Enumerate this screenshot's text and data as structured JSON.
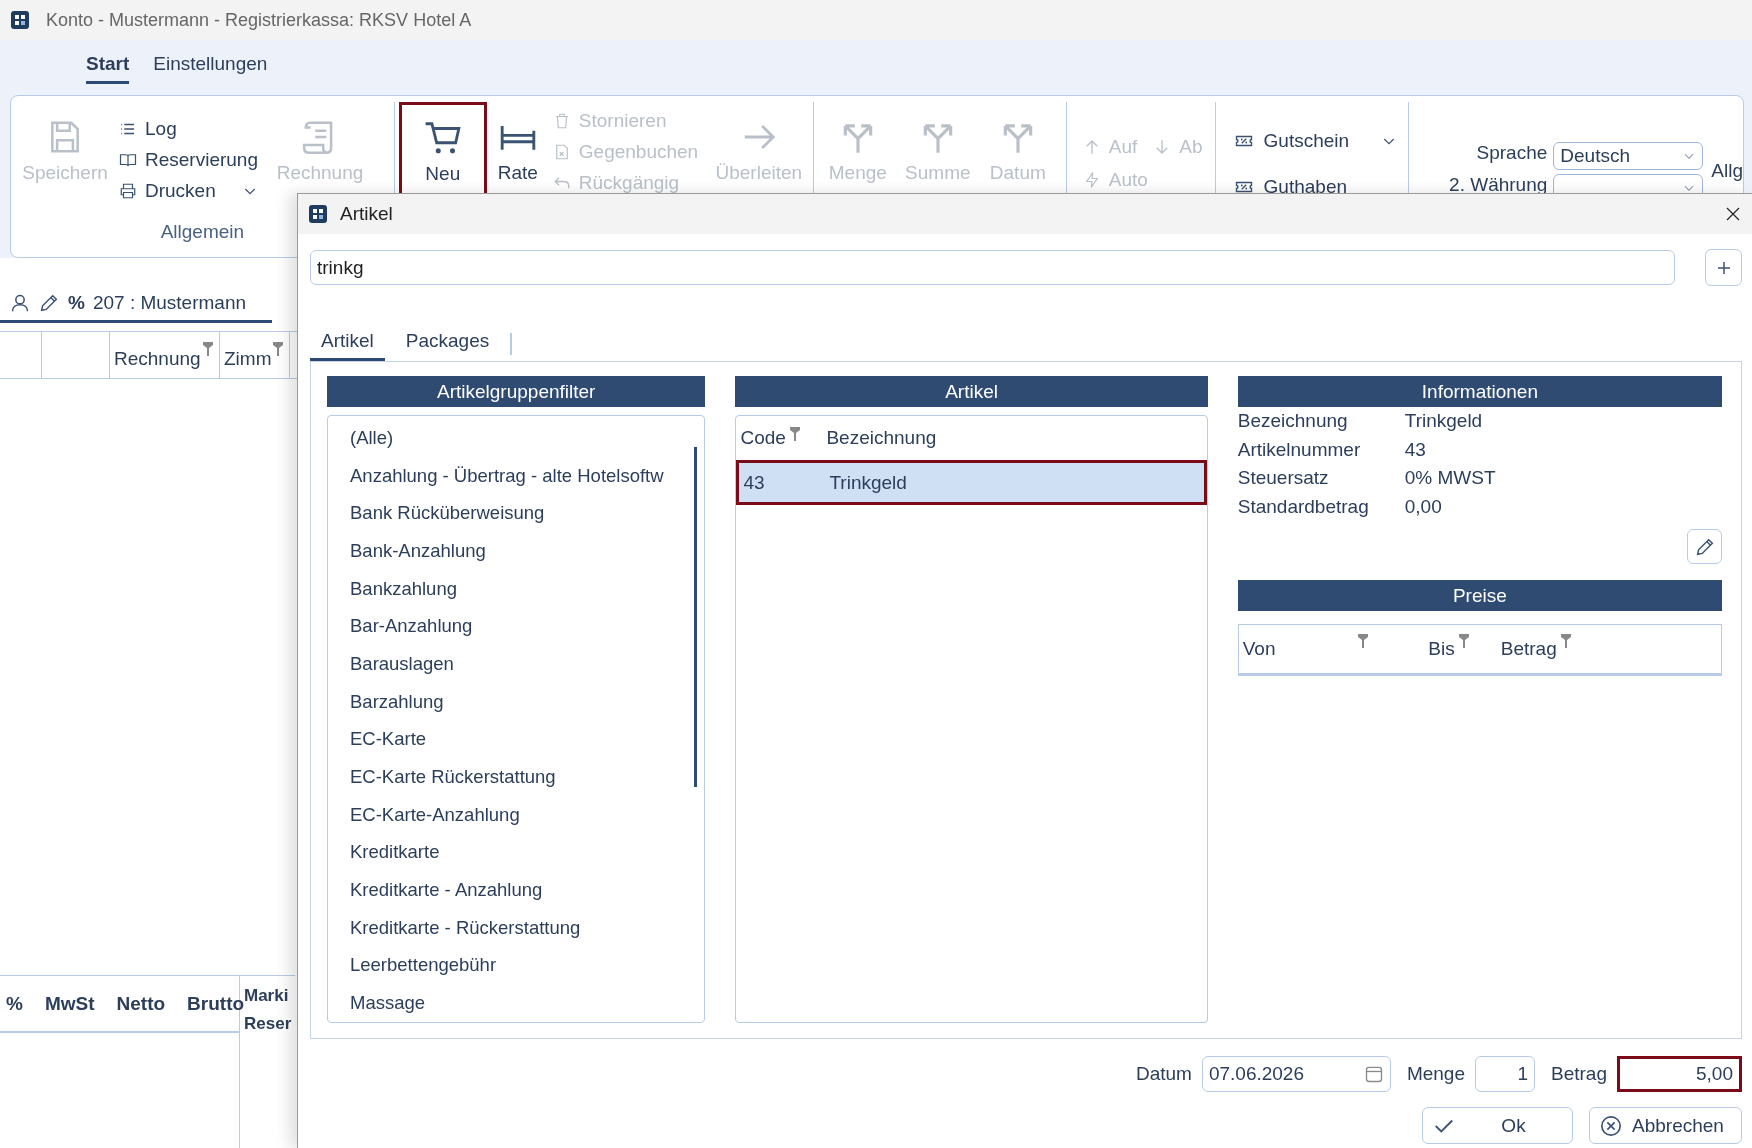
{
  "window": {
    "title": "Konto - Mustermann  - Registrierkassa: RKSV Hotel A"
  },
  "ribbon_tabs": [
    {
      "label": "Start",
      "selected": true
    },
    {
      "label": "Einstellungen",
      "selected": false
    }
  ],
  "ribbon": {
    "save_button": {
      "label": "Speichern",
      "disabled": true
    },
    "menu_items": [
      {
        "label": "Log"
      },
      {
        "label": "Reservierung"
      },
      {
        "label": "Drucken"
      }
    ],
    "invoice_button": {
      "label": "Rechnung",
      "disabled": true
    },
    "group_caption": "Allgemein",
    "new_button": {
      "label": "Neu",
      "disabled": false,
      "highlighted": true
    },
    "rate_button": {
      "label": "Rate",
      "disabled": false
    },
    "booking_actions": [
      {
        "label": "Stornieren",
        "disabled": true
      },
      {
        "label": "Gegenbuchen",
        "disabled": true
      },
      {
        "label": "Rückgängig",
        "disabled": true
      }
    ],
    "transfer_button": {
      "label": "Überleiten",
      "disabled": true
    },
    "split_buttons": [
      {
        "label": "Menge",
        "disabled": true
      },
      {
        "label": "Summe",
        "disabled": true
      },
      {
        "label": "Datum",
        "disabled": true
      }
    ],
    "move_buttons": [
      {
        "label": "Auf",
        "disabled": true
      },
      {
        "label": "Ab",
        "disabled": true
      }
    ],
    "auto_button": {
      "label": "Auto",
      "disabled": true
    },
    "voucher_buttons": [
      {
        "label": "Gutschein"
      },
      {
        "label": "Guthaben"
      }
    ],
    "language": {
      "label": "Sprache",
      "value": "Deutsch"
    },
    "currency": {
      "label": "2. Währung"
    },
    "column_label": "Allg"
  },
  "account": {
    "percent": "%",
    "label": "207 :  Mustermann"
  },
  "bookings": {
    "columns": [
      {
        "label": "Rechnung",
        "filter": true
      },
      {
        "label": "Zimm",
        "filter": true
      }
    ]
  },
  "totals": {
    "columns": [
      "%",
      "MwSt",
      "Netto",
      "Brutto"
    ],
    "side_labels": [
      "Marki",
      "Reser"
    ]
  },
  "dialog": {
    "title": "Artikel",
    "search": {
      "value": "trinkg"
    },
    "tabs": [
      {
        "label": "Artikel",
        "selected": true
      },
      {
        "label": "Packages",
        "selected": false
      }
    ],
    "group_filter": {
      "title": "Artikelgruppenfilter",
      "items": [
        {
          "label": "(Alle)",
          "selected": false
        },
        {
          "label": "Anzahlung - Übertrag - alte Hotelsoftw",
          "selected": false
        },
        {
          "label": "Bank Rücküberweisung",
          "selected": false
        },
        {
          "label": "Bank-Anzahlung",
          "selected": false
        },
        {
          "label": "Bankzahlung",
          "selected": false
        },
        {
          "label": "Bar-Anzahlung",
          "selected": false
        },
        {
          "label": "Barauslagen",
          "selected": false
        },
        {
          "label": "Barzahlung",
          "selected": false
        },
        {
          "label": "EC-Karte",
          "selected": false
        },
        {
          "label": "EC-Karte Rückerstattung",
          "selected": false
        },
        {
          "label": "EC-Karte-Anzahlung",
          "selected": false
        },
        {
          "label": "Kreditkarte",
          "selected": false
        },
        {
          "label": "Kreditkarte - Anzahlung",
          "selected": false
        },
        {
          "label": "Kreditkarte - Rückerstattung",
          "selected": false
        },
        {
          "label": "Leerbettengebühr",
          "selected": false
        },
        {
          "label": "Massage",
          "selected": false
        }
      ]
    },
    "articles": {
      "title": "Artikel",
      "columns": [
        {
          "label": "Code",
          "filter": true
        },
        {
          "label": "Bezeichnung",
          "filter": false
        }
      ],
      "rows": [
        {
          "code": "43",
          "name": "Trinkgeld",
          "selected": true,
          "highlighted": true
        }
      ]
    },
    "info": {
      "title": "Informationen",
      "fields": [
        {
          "label": "Bezeichnung",
          "value": "Trinkgeld"
        },
        {
          "label": "Artikelnummer",
          "value": "43"
        },
        {
          "label": "Steuersatz",
          "value": "0% MWST"
        },
        {
          "label": "Standardbetrag",
          "value": "0,00"
        }
      ]
    },
    "prices": {
      "title": "Preise",
      "columns": [
        {
          "label": "Von",
          "filter": true
        },
        {
          "label": "Bis",
          "filter": true
        },
        {
          "label": "Betrag",
          "filter": true
        }
      ]
    },
    "footer": {
      "date": {
        "label": "Datum",
        "value": "07.06.2026"
      },
      "quantity": {
        "label": "Menge",
        "value": "1"
      },
      "amount": {
        "label": "Betrag",
        "value": "5,00",
        "highlighted": true
      }
    },
    "buttons": [
      {
        "label": "Ok"
      },
      {
        "label": "Abbrechen"
      }
    ]
  }
}
